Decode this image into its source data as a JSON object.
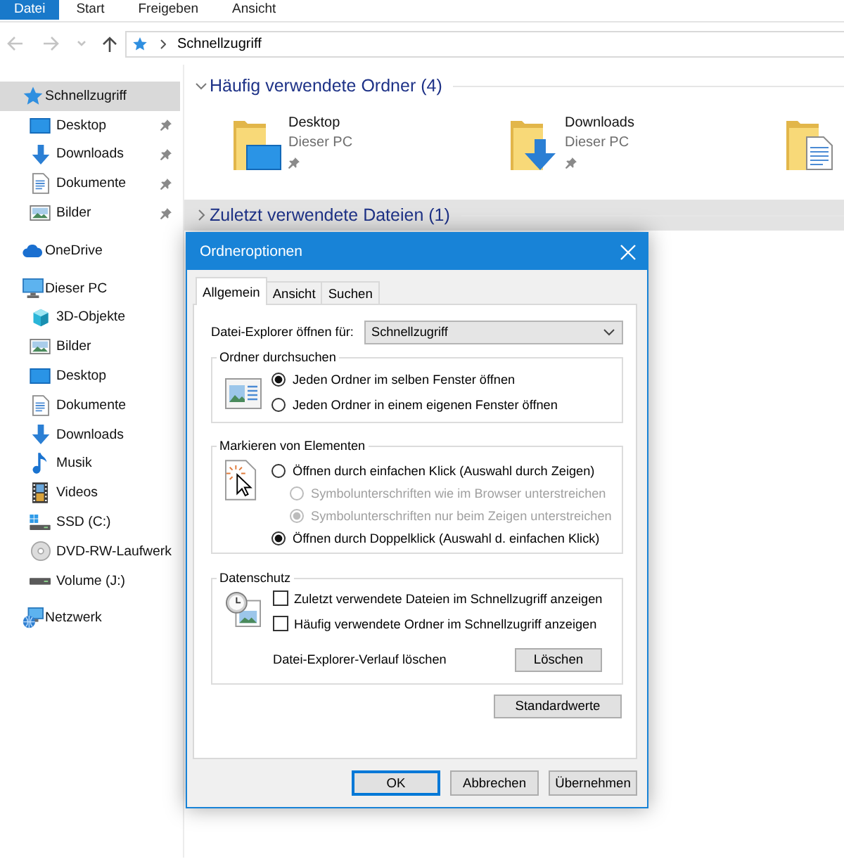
{
  "ribbon": {
    "tabs": [
      {
        "label": "Datei",
        "kind": "file"
      },
      {
        "label": "Start",
        "kind": "tab"
      },
      {
        "label": "Freigeben",
        "kind": "tab"
      },
      {
        "label": "Ansicht",
        "kind": "tab"
      }
    ]
  },
  "navigation": {
    "buttons": [
      {
        "kind": "back",
        "disabled": true
      },
      {
        "kind": "forward",
        "disabled": true
      },
      {
        "kind": "recent",
        "disabled": true
      },
      {
        "kind": "up",
        "disabled": false
      }
    ],
    "address": {
      "path": [
        "Schnellzugriff"
      ]
    }
  },
  "navigation_pane": {
    "items": [
      {
        "label": "Schnellzugriff",
        "kind": "quickaccess",
        "selected": true,
        "pinned": false,
        "children": [
          {
            "label": "Desktop",
            "kind": "desktop",
            "selected": false,
            "pinned": true
          },
          {
            "label": "Downloads",
            "kind": "downloads",
            "selected": false,
            "pinned": true
          },
          {
            "label": "Dokumente",
            "kind": "documents",
            "selected": false,
            "pinned": true
          },
          {
            "label": "Bilder",
            "kind": "pictures",
            "selected": false,
            "pinned": true
          }
        ]
      },
      {
        "label": "OneDrive",
        "kind": "cloud",
        "selected": false,
        "pinned": false
      },
      {
        "label": "Dieser PC",
        "kind": "pc",
        "selected": false,
        "pinned": false,
        "children": [
          {
            "label": "3D-Objekte",
            "kind": "objects3d",
            "selected": false,
            "pinned": false
          },
          {
            "label": "Bilder",
            "kind": "pictures",
            "selected": false,
            "pinned": false
          },
          {
            "label": "Desktop",
            "kind": "desktop",
            "selected": false,
            "pinned": false
          },
          {
            "label": "Dokumente",
            "kind": "documents",
            "selected": false,
            "pinned": false
          },
          {
            "label": "Downloads",
            "kind": "downloads",
            "selected": false,
            "pinned": false
          },
          {
            "label": "Musik",
            "kind": "music",
            "selected": false,
            "pinned": false
          },
          {
            "label": "Videos",
            "kind": "videos",
            "selected": false,
            "pinned": false
          },
          {
            "label": "SSD (C:)",
            "kind": "systemdrive",
            "selected": false,
            "pinned": false
          },
          {
            "label": "DVD-RW-Laufwerk",
            "kind": "disc",
            "selected": false,
            "pinned": false
          },
          {
            "label": "Volume (J:)",
            "kind": "drive",
            "selected": false,
            "pinned": false
          }
        ]
      },
      {
        "label": "Netzwerk",
        "kind": "network",
        "selected": false,
        "pinned": false
      }
    ]
  },
  "content": {
    "sections": [
      {
        "title": "Häufig verwendete Ordner (4)",
        "expanded": true,
        "selected": false,
        "items": [
          {
            "name": "Desktop",
            "location": "Dieser PC",
            "kind": "desktop",
            "pinned": true
          },
          {
            "name": "Downloads",
            "location": "Dieser PC",
            "kind": "downloads",
            "pinned": true
          },
          {
            "kind": "documents"
          }
        ]
      },
      {
        "title": "Zuletzt verwendete Dateien (1)",
        "expanded": false,
        "selected": true
      }
    ]
  },
  "dialog": {
    "title": "Ordneroptionen",
    "tabs": [
      {
        "label": "Allgemein",
        "selected": true
      },
      {
        "label": "Ansicht",
        "selected": false
      },
      {
        "label": "Suchen",
        "selected": false
      }
    ],
    "open_for": {
      "label": "Datei-Explorer öffnen für:",
      "value": "Schnellzugriff"
    },
    "groups": [
      {
        "title": "Ordner durchsuchen",
        "kind": "browse",
        "options": [
          {
            "kind": "radio",
            "label": "Jeden Ordner im selben Fenster öffnen",
            "selected": true,
            "disabled": false
          },
          {
            "kind": "radio",
            "label": "Jeden Ordner in einem eigenen Fenster öffnen",
            "selected": false,
            "disabled": false
          }
        ]
      },
      {
        "title": "Markieren von Elementen",
        "kind": "click",
        "options": [
          {
            "kind": "radio",
            "label": "Öffnen durch einfachen Klick (Auswahl durch Zeigen)",
            "selected": false,
            "disabled": false,
            "children": [
              {
                "kind": "radio",
                "label": "Symbolunterschriften wie im Browser unterstreichen",
                "selected": false,
                "disabled": true
              },
              {
                "kind": "radio",
                "label": "Symbolunterschriften nur beim Zeigen unterstreichen",
                "selected": true,
                "disabled": true
              }
            ]
          },
          {
            "kind": "radio",
            "label": "Öffnen durch Doppelklick (Auswahl d. einfachen Klick)",
            "selected": true,
            "disabled": false
          }
        ]
      },
      {
        "title": "Datenschutz",
        "kind": "privacy",
        "options": [
          {
            "kind": "checkbox",
            "label": "Zuletzt verwendete Dateien im Schnellzugriff anzeigen",
            "checked": false,
            "disabled": false
          },
          {
            "kind": "checkbox",
            "label": "Häufig verwendete Ordner im Schnellzugriff anzeigen",
            "checked": false,
            "disabled": false
          }
        ],
        "action": {
          "label": "Datei-Explorer-Verlauf löschen",
          "button": "Löschen"
        }
      }
    ],
    "defaults_button": "Standardwerte",
    "buttons": [
      {
        "label": "OK",
        "default": true
      },
      {
        "label": "Abbrechen",
        "default": false
      },
      {
        "label": "Übernehmen",
        "default": false
      }
    ]
  }
}
